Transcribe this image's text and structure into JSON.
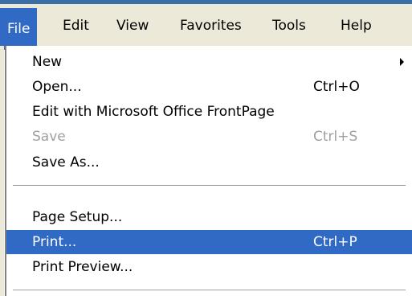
{
  "menubar": {
    "items": [
      {
        "label": "File"
      },
      {
        "label": "Edit"
      },
      {
        "label": "View"
      },
      {
        "label": "Favorites"
      },
      {
        "label": "Tools"
      },
      {
        "label": "Help"
      }
    ]
  },
  "file_menu": {
    "items": [
      {
        "label": "New",
        "shortcut": "",
        "has_submenu": true
      },
      {
        "label": "Open...",
        "shortcut": "Ctrl+O"
      },
      {
        "label": "Edit with Microsoft Office FrontPage",
        "shortcut": ""
      },
      {
        "label": "Save",
        "shortcut": "Ctrl+S",
        "disabled": true
      },
      {
        "label": "Save As...",
        "shortcut": ""
      },
      {
        "label": "Page Setup...",
        "shortcut": ""
      },
      {
        "label": "Print...",
        "shortcut": "Ctrl+P",
        "selected": true
      },
      {
        "label": "Print Preview...",
        "shortcut": ""
      }
    ]
  },
  "colors": {
    "highlight": "#316ac5",
    "menubar_bg": "#ece9d8",
    "disabled_text": "#a0a0a0",
    "titlebar_strip": "#3a6ea5"
  },
  "icons": [
    "submenu-arrow-icon"
  ]
}
